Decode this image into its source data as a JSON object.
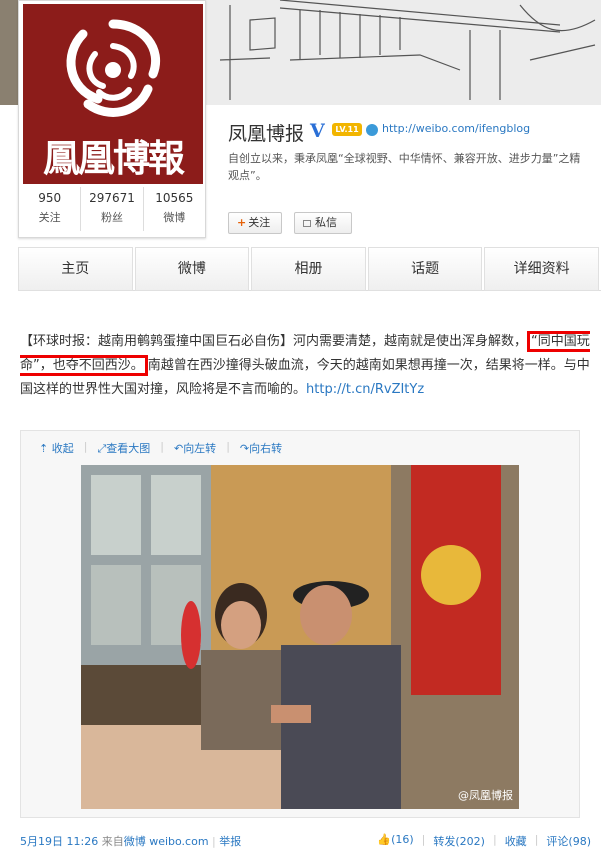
{
  "profile": {
    "logo_text": "鳳凰博報",
    "name": "凤凰博报",
    "verified_badge": "V",
    "level_badge": "LV.11",
    "url": "http://weibo.com/ifengblog",
    "bio_line1": "自创立以来，秉承凤凰“全球视野、中华情怀、兼容开放、进步力量”之精",
    "bio_line2": "观点”。",
    "stats": [
      {
        "num": "950",
        "label": "关注"
      },
      {
        "num": "297671",
        "label": "粉丝"
      },
      {
        "num": "10565",
        "label": "微博"
      }
    ],
    "follow_label": "关注",
    "message_label": "私信"
  },
  "tabs": [
    "主页",
    "微博",
    "相册",
    "话题",
    "详细资料"
  ],
  "post": {
    "text_part1": "【环球时报：越南用鹌鹑蛋撞中国巨石必自伤】河内需要清楚，越南就是使出浑身解数，",
    "highlight": "“同中国玩命”，也夺不回西沙。",
    "text_part2": "南越曾在西沙撞得头破血流，今天的越南如果想再撞一次，结果将一样。与中国这样的世界性大国对撞，风险将是不言而喻的。",
    "link": "http://t.cn/RvZItYz",
    "media_actions": [
      "收起",
      "查看大图",
      "向左转",
      "向右转"
    ],
    "watermark": "@凤凰博报",
    "date": "5月19日 11:26",
    "source_prefix": "来自",
    "source": "微博 weibo.com",
    "report": "举报",
    "like": "(16)",
    "repost": "转发(202)",
    "favorite": "收藏",
    "comment": "评论(98)"
  },
  "colors": {
    "link_blue": "#2a78c2",
    "logo_red": "#8c1c1a",
    "highlight_red": "#e00000"
  }
}
